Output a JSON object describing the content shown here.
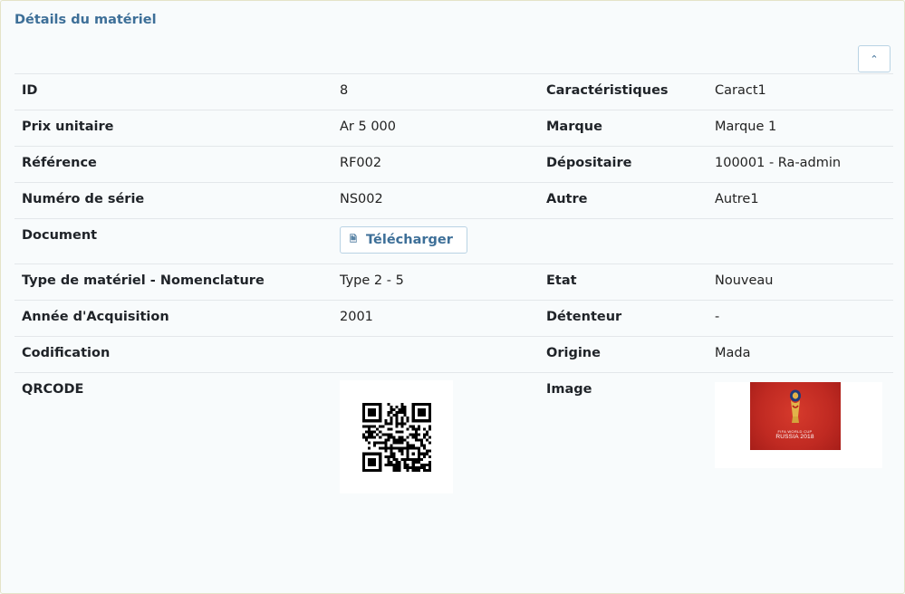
{
  "panel": {
    "title": "Détails du matériel"
  },
  "rows": [
    {
      "l1": "ID",
      "v1": "8",
      "l2": "Caractéristiques",
      "v2": "Caract1"
    },
    {
      "l1": "Prix unitaire",
      "v1": "Ar 5 000",
      "l2": "Marque",
      "v2": "Marque 1"
    },
    {
      "l1": "Référence",
      "v1": "RF002",
      "l2": "Dépositaire",
      "v2": "100001 - Ra-admin"
    },
    {
      "l1": "Numéro de série",
      "v1": "NS002",
      "l2": "Autre",
      "v2": "Autre1"
    },
    {
      "l1": "Document",
      "button": "Télécharger"
    },
    {
      "l1": "Type de matériel - Nomenclature",
      "v1": "Type 2 - 5",
      "l2": "Etat",
      "v2": "Nouveau"
    },
    {
      "l1": "Année d'Acquisition",
      "v1": "2001",
      "l2": "Détenteur",
      "v2": "-"
    },
    {
      "l1": "Codification",
      "v1": "",
      "l2": "Origine",
      "v2": "Mada"
    },
    {
      "l1": "QRCODE",
      "l2": "Image"
    }
  ],
  "image": {
    "caption_small": "FIFA WORLD CUP",
    "caption": "RUSSIA 2018"
  },
  "icons": {
    "collapse": "chevron-up-icon",
    "download": "file-icon"
  },
  "colors": {
    "accent": "#3d6f98",
    "border": "#b9d3e4"
  }
}
